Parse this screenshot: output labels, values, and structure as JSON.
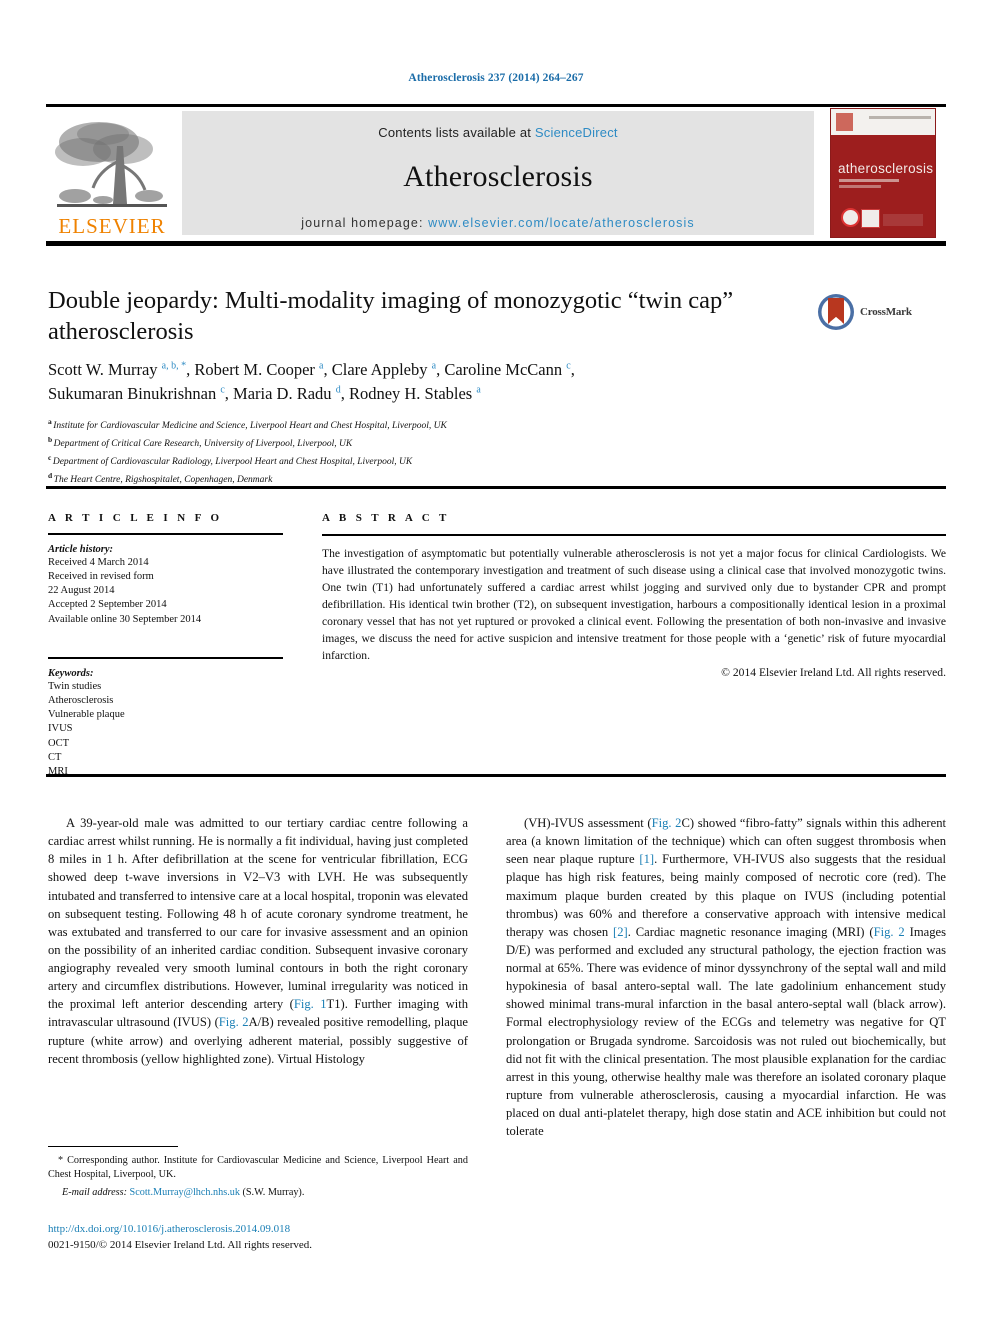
{
  "running_head": "Atherosclerosis 237 (2014) 264–267",
  "masthead": {
    "contents_prefix": "Contents lists available at ",
    "sciencedirect": "ScienceDirect",
    "journal_title": "Atherosclerosis",
    "homepage_prefix": "journal homepage: ",
    "homepage_url": "www.elsevier.com/locate/atherosclerosis",
    "publisher_wordmark": "ELSEVIER",
    "cover_title": "atherosclerosis",
    "accent_link_color": "#2e8bc4",
    "publisher_color": "#ef8200",
    "cover_color": "#9d1e1e"
  },
  "article": {
    "title": "Double jeopardy: Multi-modality imaging of monozygotic “twin cap” atherosclerosis",
    "crossmark_label": "CrossMark",
    "authors_line_1": "Scott W. Murray <sup>a, b, *</sup>, Robert M. Cooper <sup>a</sup>, Clare Appleby <sup>a</sup>, Caroline McCann <sup>c</sup>,",
    "authors_line_2": "Sukumaran Binukrishnan <sup>c</sup>, Maria D. Radu <sup>d</sup>, Rodney H. Stables <sup>a</sup>",
    "affiliations": [
      {
        "marker": "a",
        "text": "Institute for Cardiovascular Medicine and Science, Liverpool Heart and Chest Hospital, Liverpool, UK"
      },
      {
        "marker": "b",
        "text": "Department of Critical Care Research, University of Liverpool, Liverpool, UK"
      },
      {
        "marker": "c",
        "text": "Department of Cardiovascular Radiology, Liverpool Heart and Chest Hospital, Liverpool, UK"
      },
      {
        "marker": "d",
        "text": "The Heart Centre, Rigshospitalet, Copenhagen, Denmark"
      }
    ]
  },
  "article_info": {
    "heading": "A R T I C L E   I N F O",
    "history_label": "Article history:",
    "history": [
      "Received 4 March 2014",
      "Received in revised form",
      "22 August 2014",
      "Accepted 2 September 2014",
      "Available online 30 September 2014"
    ],
    "keywords_label": "Keywords:",
    "keywords": [
      "Twin studies",
      "Atherosclerosis",
      "Vulnerable plaque",
      "IVUS",
      "OCT",
      "CT",
      "MRI"
    ]
  },
  "abstract": {
    "heading": "A B S T R A C T",
    "text": "The investigation of asymptomatic but potentially vulnerable atherosclerosis is not yet a major focus for clinical Cardiologists. We have illustrated the contemporary investigation and treatment of such disease using a clinical case that involved monozygotic twins. One twin (T1) had unfortunately suffered a cardiac arrest whilst jogging and survived only due to bystander CPR and prompt defibrillation. His identical twin brother (T2), on subsequent investigation, harbours a compositionally identical lesion in a proximal coronary vessel that has not yet ruptured or provoked a clinical event. Following the presentation of both non-invasive and invasive images, we discuss the need for active suspicion and intensive treatment for those people with a ‘genetic’ risk of future myocardial infarction.",
    "copyright": "© 2014 Elsevier Ireland Ltd. All rights reserved."
  },
  "body": {
    "left_paragraph_html": "A 39-year-old male was admitted to our tertiary cardiac centre following a cardiac arrest whilst running. He is normally a fit individual, having just completed 8 miles in 1 h. After defibrillation at the scene for ventricular fibrillation, ECG showed deep t-wave inversions in V2–V3 with LVH. He was subsequently intubated and transferred to intensive care at a local hospital, troponin was elevated on subsequent testing. Following 48 h of acute coronary syndrome treatment, he was extubated and transferred to our care for invasive assessment and an opinion on the possibility of an inherited cardiac condition. Subsequent invasive coronary angiography revealed very smooth luminal contours in both the right coronary artery and circumflex distributions. However, luminal irregularity was noticed in the proximal left anterior descending artery (<span class=\"lnk\">Fig. 1</span>T1). Further imaging with intravascular ultrasound (IVUS) (<span class=\"lnk\">Fig. 2</span>A/B) revealed positive remodelling, plaque rupture (white arrow) and overlying adherent material, possibly suggestive of recent thrombosis (yellow highlighted zone). Virtual Histology",
    "right_paragraph_html": "(VH)-IVUS assessment (<span class=\"lnk\">Fig. 2</span>C) showed “fibro-fatty” signals within this adherent area (a known limitation of the technique) which can often suggest thrombosis when seen near plaque rupture <span class=\"lnk\">[1]</span>. Furthermore, VH-IVUS also suggests that the residual plaque has high risk features, being mainly composed of necrotic core (red). The maximum plaque burden created by this plaque on IVUS (including potential thrombus) was 60% and therefore a conservative approach with intensive medical therapy was chosen <span class=\"lnk\">[2]</span>. Cardiac magnetic resonance imaging (MRI) (<span class=\"lnk\">Fig. 2</span> Images D/E) was performed and excluded any structural pathology, the ejection fraction was normal at 65%. There was evidence of minor dyssynchrony of the septal wall and mild hypokinesia of basal antero-septal wall. The late gadolinium enhancement study showed minimal trans-mural infarction in the basal antero-septal wall (black arrow). Formal electrophysiology review of the ECGs and telemetry was negative for QT prolongation or Brugada syndrome. Sarcoidosis was not ruled out biochemically, but did not fit with the clinical presentation. The most plausible explanation for the cardiac arrest in this young, otherwise healthy male was therefore an isolated coronary plaque rupture from vulnerable atherosclerosis, causing a myocardial infarction. He was placed on dual anti-platelet therapy, high dose statin and ACE inhibition but could not tolerate"
  },
  "footnotes": {
    "corresponding_html": "* Corresponding author. Institute for Cardiovascular Medicine and Science, Liverpool Heart and Chest Hospital, Liverpool, UK.",
    "email_label": "E-mail address:",
    "email": "Scott.Murray@lhch.nhs.uk",
    "email_owner": "(S.W. Murray)."
  },
  "doi": {
    "url": "http://dx.doi.org/10.1016/j.atherosclerosis.2014.09.018",
    "issn_line": "0021-9150/© 2014 Elsevier Ireland Ltd. All rights reserved."
  }
}
